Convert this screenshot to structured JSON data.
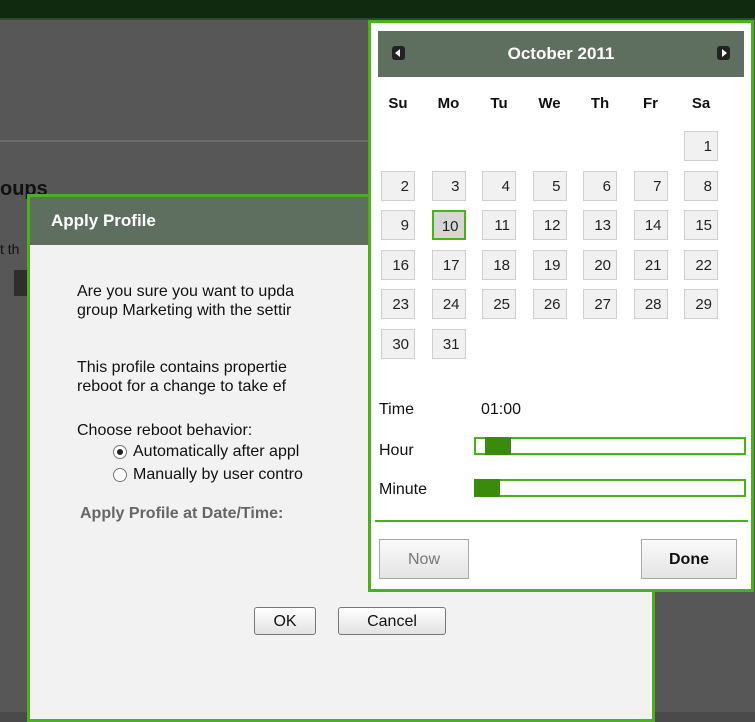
{
  "background": {
    "heading": "oups",
    "sub_text": "t th"
  },
  "dialog": {
    "title": "Apply Profile",
    "paragraph1_line1": "Are you sure you want to upda",
    "paragraph1_line2": "group Marketing with the settir",
    "paragraph2_line1": "This profile contains propertie",
    "paragraph2_line2": "reboot for a change to take ef",
    "reboot_label": "Choose reboot behavior:",
    "options": [
      {
        "label": "Automatically after appl",
        "checked": true
      },
      {
        "label": "Manually by user contro",
        "checked": false
      }
    ],
    "apply_label": "Apply Profile at Date/Time:",
    "ok_label": "OK",
    "cancel_label": "Cancel"
  },
  "calendar": {
    "title": "October 2011",
    "weekdays": [
      "Su",
      "Mo",
      "Tu",
      "We",
      "Th",
      "Fr",
      "Sa"
    ],
    "first_weekday_index": 6,
    "days_in_month": 31,
    "selected_day": 10,
    "time_label": "Time",
    "time_value": "01:00",
    "hour_label": "Hour",
    "minute_label": "Minute",
    "hour_value": 1,
    "minute_value": 0,
    "now_label": "Now",
    "done_label": "Done"
  },
  "colors": {
    "accent": "#4caf1c",
    "header_bg": "#5f6f5f"
  }
}
